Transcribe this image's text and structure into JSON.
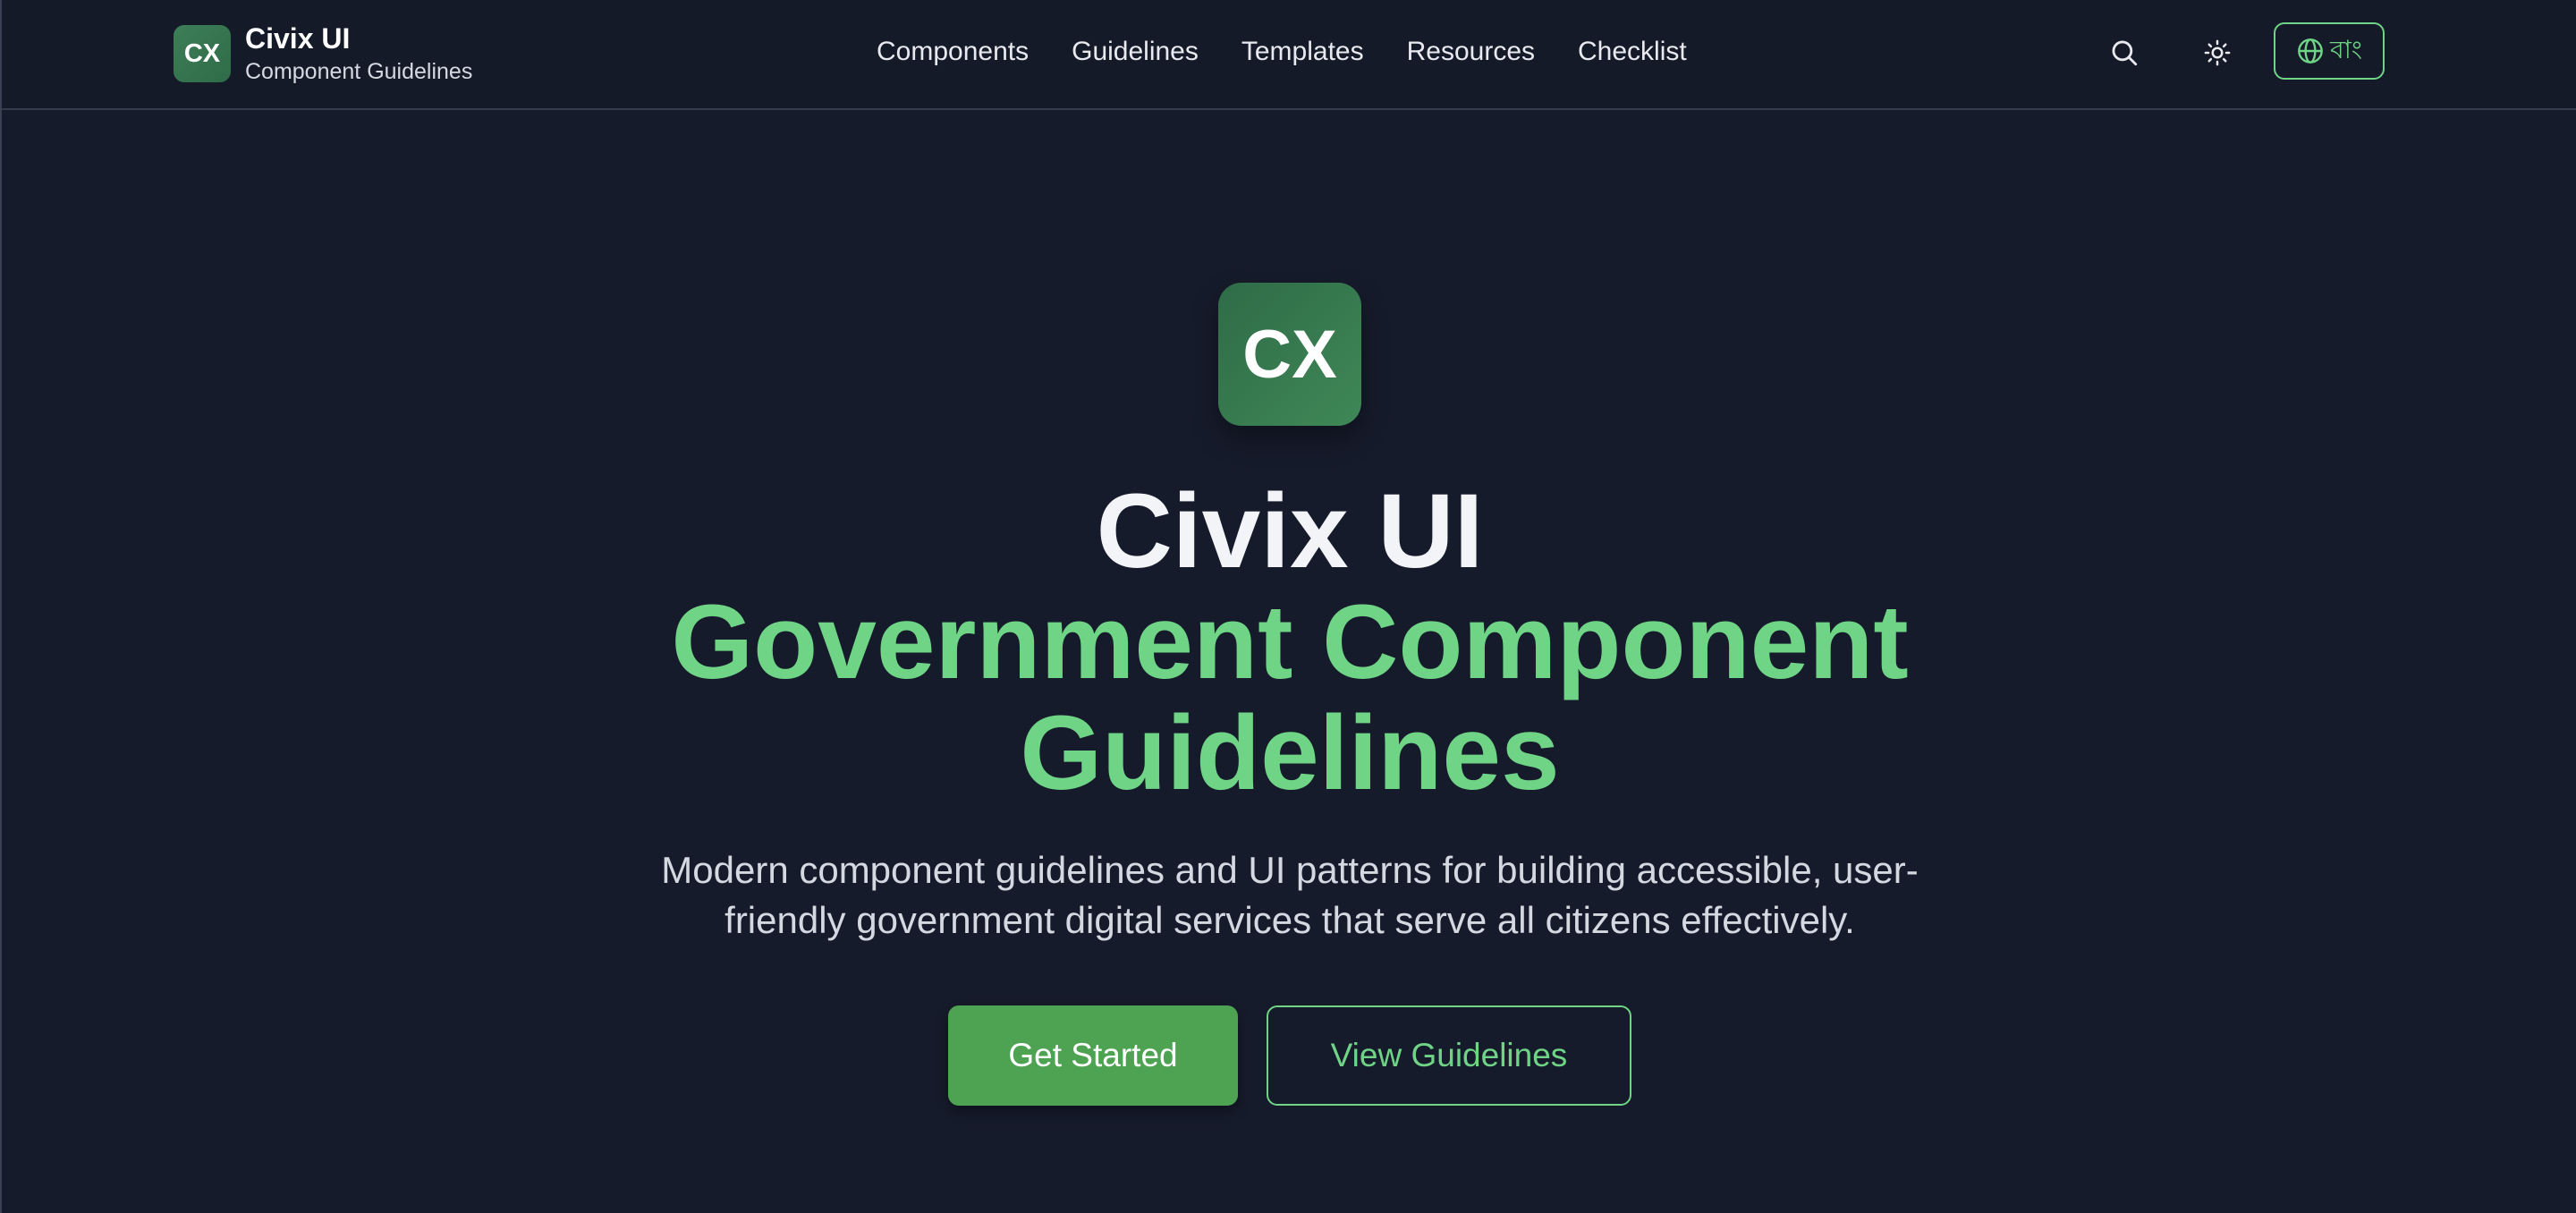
{
  "header": {
    "brand": {
      "logo_text": "CX",
      "title": "Civix UI",
      "subtitle": "Component Guidelines"
    },
    "nav": [
      {
        "label": "Components"
      },
      {
        "label": "Guidelines"
      },
      {
        "label": "Templates"
      },
      {
        "label": "Resources"
      },
      {
        "label": "Checklist"
      }
    ],
    "icons": {
      "search": "search-icon",
      "theme": "sun-icon",
      "language": "globe-icon"
    },
    "language_label": "বাং"
  },
  "hero": {
    "logo_text": "CX",
    "title": "Civix UI",
    "title_highlight": "Government Component Guidelines",
    "description": "Modern component guidelines and UI patterns for building accessible, user-friendly government digital services that serve all citizens effectively.",
    "primary_button": "Get Started",
    "secondary_button": "View Guidelines"
  },
  "colors": {
    "background": "#161b2b",
    "accent": "#6fd486",
    "primary_button": "#4ea352",
    "logo": "#2f6b48"
  }
}
